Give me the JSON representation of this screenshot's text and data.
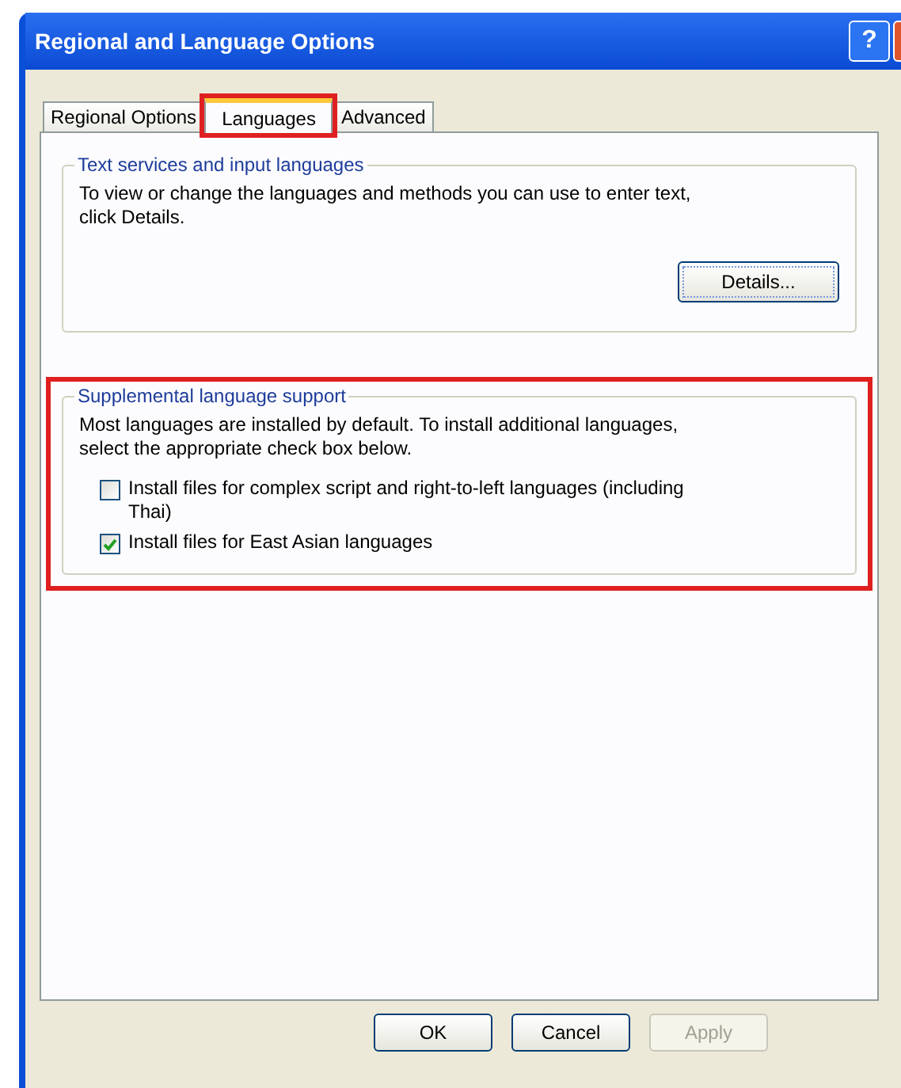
{
  "window": {
    "title": "Regional and Language Options",
    "help_button": "?"
  },
  "tabs": [
    {
      "label": "Regional Options",
      "selected": false,
      "highlighted": false
    },
    {
      "label": "Languages",
      "selected": true,
      "highlighted": true
    },
    {
      "label": "Advanced",
      "selected": false,
      "highlighted": false
    }
  ],
  "groups": [
    {
      "title": "Text services and input languages",
      "text": "To view or change the languages and methods you can use to enter text, click Details.",
      "button": "Details..."
    },
    {
      "title": "Supplemental language support",
      "highlighted": true,
      "text": "Most languages are installed by default. To install additional languages, select the appropriate check box below.",
      "checkboxes": [
        {
          "label": "Install files for complex script and right-to-left languages (including Thai)",
          "checked": false
        },
        {
          "label": "Install files for East Asian languages",
          "checked": true
        }
      ]
    }
  ],
  "buttons": [
    {
      "label": "OK",
      "disabled": false
    },
    {
      "label": "Cancel",
      "disabled": false
    },
    {
      "label": "Apply",
      "disabled": true
    }
  ]
}
